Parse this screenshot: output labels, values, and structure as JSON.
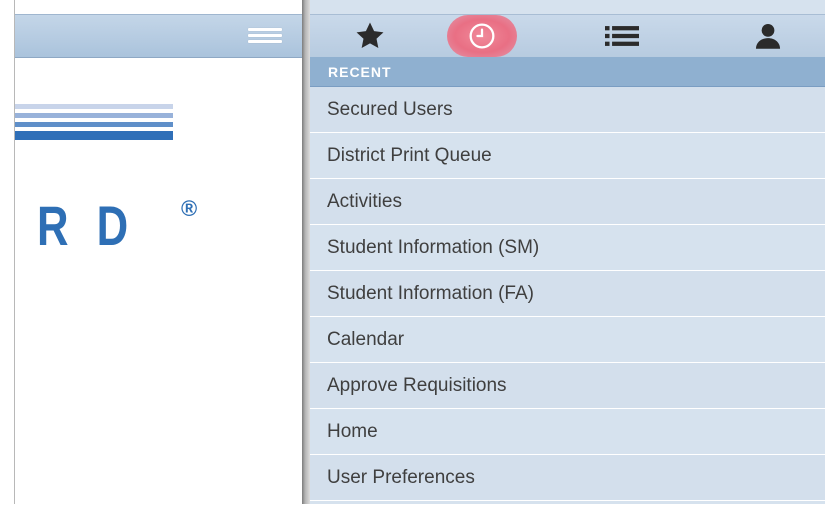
{
  "app": {
    "logo": {
      "letters": [
        "R",
        "D"
      ],
      "registered_mark": "®"
    }
  },
  "left_header": {
    "menu_icon": "hamburger-icon"
  },
  "toolbar": {
    "buttons": [
      {
        "name": "favorites",
        "icon": "star-icon"
      },
      {
        "name": "recent",
        "icon": "clock-icon",
        "active": true,
        "active_color": "#e96f84"
      },
      {
        "name": "list",
        "icon": "list-icon"
      },
      {
        "name": "account",
        "icon": "user-icon"
      }
    ]
  },
  "menu": {
    "section_title": "RECENT",
    "items": [
      "Secured Users",
      "District Print Queue",
      "Activities",
      "Student Information (SM)",
      "Student Information (FA)",
      "Calendar",
      "Approve Requisitions",
      "Home",
      "User Preferences"
    ]
  },
  "colors": {
    "header_blue": "#b7cbe0",
    "section_blue": "#8fb0d0",
    "menu_bg": "#d3dfec",
    "logo_blue": "#2e6fb5"
  }
}
